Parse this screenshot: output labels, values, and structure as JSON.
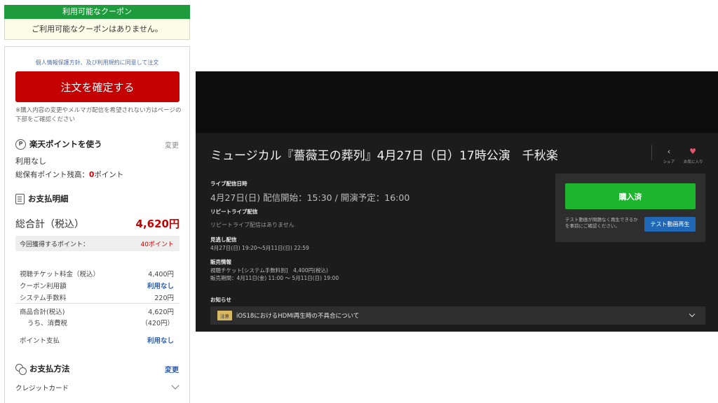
{
  "coupon": {
    "header": "利用可能なクーポン",
    "message": "ご利用可能なクーポンはありません。"
  },
  "order": {
    "agreement": "個人情報保護方針、及び利用規約に同意して注文",
    "confirm_button": "注文を確定する",
    "note": "※購入内容の変更やメルマガ配信を希望されない方はページの下部をご確認ください"
  },
  "points": {
    "icon": "P",
    "title": "楽天ポイントを使う",
    "change": "変更",
    "usage": "利用なし",
    "balance_label": "総保有ポイント残高：",
    "balance_value": "0",
    "balance_unit": "ポイント"
  },
  "payment_details": {
    "title": "お支払明細",
    "total_label": "総合計（税込）",
    "total_value": "4,620円",
    "earn_label": "今回獲得するポイント：",
    "earn_value": "40ポイント",
    "rows": [
      {
        "label": "視聴チケット料金（税込）",
        "value": "4,400円"
      },
      {
        "label": "クーポン利用額",
        "value": "利用なし"
      },
      {
        "label": "システム手数料",
        "value": "220円"
      },
      {
        "label": "商品合計(税込)",
        "value": "4,620円"
      },
      {
        "label": "うち、消費税",
        "value": "（420円）"
      },
      {
        "label": "ポイント支払",
        "value": "利用なし"
      }
    ]
  },
  "payment_method": {
    "title": "お支払方法",
    "change": "変更",
    "selected": "クレジットカード"
  },
  "event": {
    "title": "ミュージカル『薔薇王の葬列』4月27日（日）17時公演　千秋楽",
    "share_label": "シェア",
    "favorite_label": "お気に入り",
    "live_label": "ライブ配信日時",
    "live_value": "4月27日(日) 配信開始：15:30 / 開演予定：16:00",
    "repeat_label": "リピートライブ配信",
    "repeat_value": "リピートライブ配信はありません",
    "archive_label": "見逃し配信",
    "archive_value": "4月27日(日) 19:20～5月11日(日) 22:59",
    "sales_label": "販売情報",
    "sales_line1": "視聴チケット[システム手数料別]　4,400円(税込)",
    "sales_line2": "販売期間：4月11日(金) 11:00 ～ 5月11日(日) 19:00",
    "notice_label": "お知らせ",
    "notice_badge": "注意",
    "notice_text": "iOS18におけるHDMI再生時の不具合について"
  },
  "purchase": {
    "button": "購入済",
    "note": "テスト動画が問題なく再生できるかを事前にご確認ください。",
    "test_button": "テスト動画再生"
  }
}
